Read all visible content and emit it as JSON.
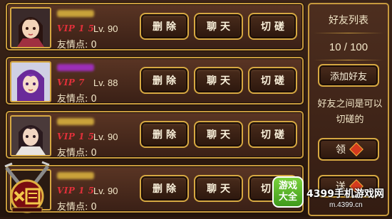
{
  "panel": {
    "title": "好友列表",
    "count": "10 / 100",
    "add_friend_label": "添加好友",
    "hint": "好友之间是可以切磋的",
    "collect_label": "领",
    "send_label": "送"
  },
  "buttons": {
    "delete": "删除",
    "chat": "聊天",
    "spar": "切磋"
  },
  "friends": [
    {
      "vip": "VIP 1 5",
      "level": "Lv. 90",
      "friendship": "友情点: 0",
      "name_color": "#c9a23a"
    },
    {
      "vip": "VIP 7",
      "level": "Lv. 88",
      "friendship": "友情点: 0",
      "name_color": "#9c2fb8"
    },
    {
      "vip": "VIP 1 5",
      "level": "Lv. 90",
      "friendship": "友情点: 0",
      "name_color": "#c9a23a"
    },
    {
      "vip": "VIP 1 5",
      "level": "Lv. 90",
      "friendship": "友情点: 0",
      "name_color": "#c9a23a"
    }
  ],
  "watermark": {
    "badge_line1": "游戏",
    "badge_line2": "大全",
    "text": "4399手机游戏网",
    "url": "m.4399.cn"
  }
}
